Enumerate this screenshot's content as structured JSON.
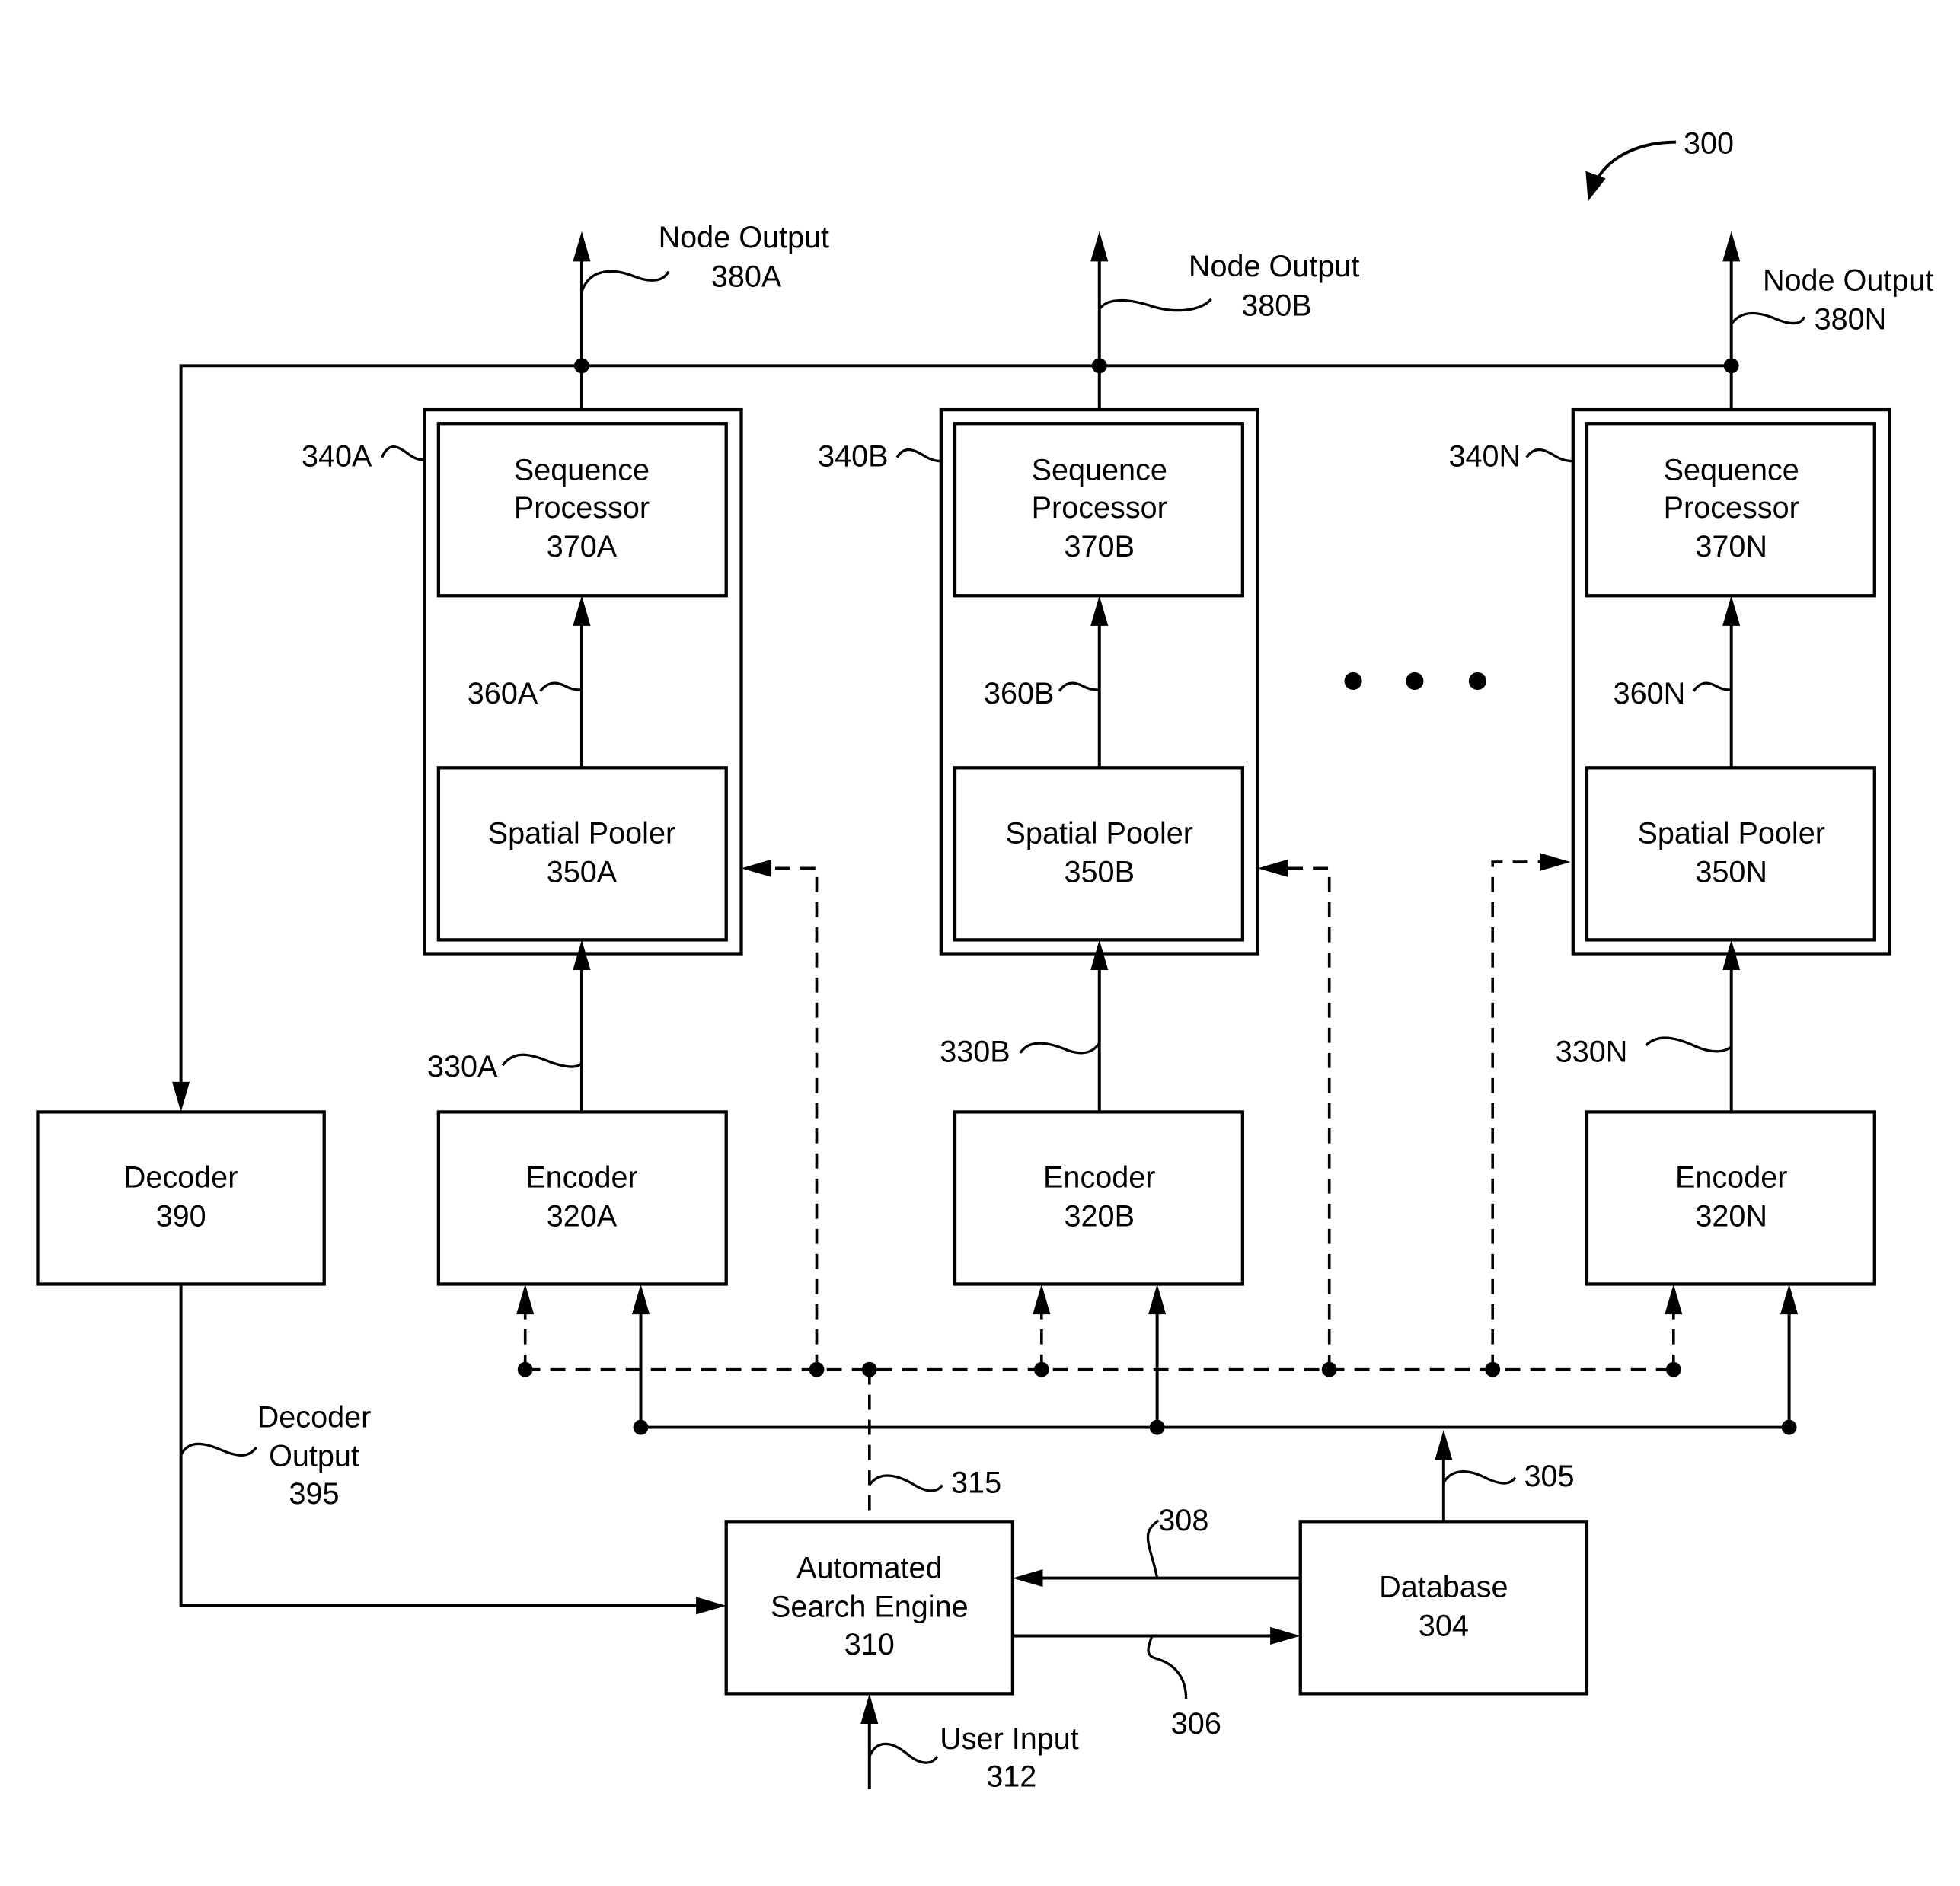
{
  "figure": {
    "ref": "300",
    "colors": {
      "ink": "#000000",
      "background": "#ffffff"
    }
  },
  "nodes": [
    {
      "node_ref": "340A",
      "sequence_processor": {
        "line1": "Sequence",
        "line2": "Processor",
        "ref": "370A"
      },
      "spatial_pooler": {
        "line1": "Spatial Pooler",
        "ref": "350A"
      },
      "encoder": {
        "line1": "Encoder",
        "ref": "320A"
      },
      "link_360": "360A",
      "link_330": "330A",
      "output": {
        "line1": "Node Output",
        "ref": "380A"
      }
    },
    {
      "node_ref": "340B",
      "sequence_processor": {
        "line1": "Sequence",
        "line2": "Processor",
        "ref": "370B"
      },
      "spatial_pooler": {
        "line1": "Spatial Pooler",
        "ref": "350B"
      },
      "encoder": {
        "line1": "Encoder",
        "ref": "320B"
      },
      "link_360": "360B",
      "link_330": "330B",
      "output": {
        "line1": "Node Output",
        "ref": "380B"
      }
    },
    {
      "node_ref": "340N",
      "sequence_processor": {
        "line1": "Sequence",
        "line2": "Processor",
        "ref": "370N"
      },
      "spatial_pooler": {
        "line1": "Spatial Pooler",
        "ref": "350N"
      },
      "encoder": {
        "line1": "Encoder",
        "ref": "320N"
      },
      "link_360": "360N",
      "link_330": "330N",
      "output": {
        "line1": "Node Output",
        "ref": "380N"
      }
    }
  ],
  "ellipsis": "• • •",
  "decoder": {
    "line1": "Decoder",
    "ref": "390"
  },
  "decoder_output": {
    "line1": "Decoder",
    "line2": "Output",
    "ref": "395"
  },
  "search_engine": {
    "line1": "Automated",
    "line2": "Search Engine",
    "ref": "310"
  },
  "database": {
    "line1": "Database",
    "ref": "304"
  },
  "user_input": {
    "line1": "User Input",
    "ref": "312"
  },
  "links": {
    "control": "315",
    "data_bus": "305",
    "query": "306",
    "results": "308"
  }
}
